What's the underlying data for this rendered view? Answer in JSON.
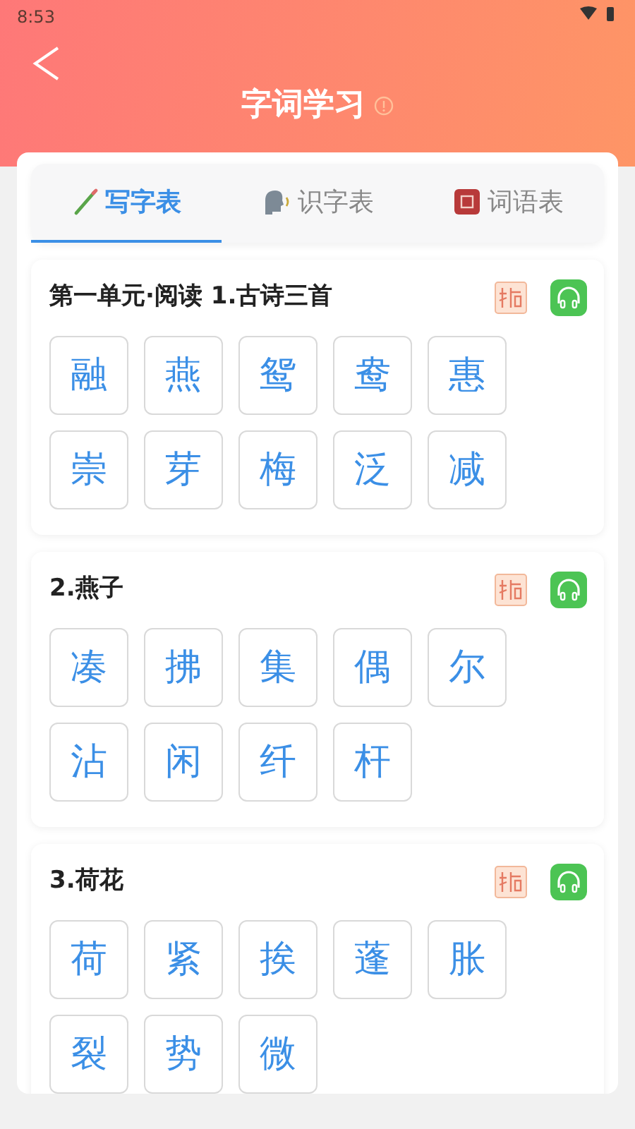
{
  "status_bar": {
    "time": "8:53"
  },
  "header": {
    "title": "字词学习"
  },
  "tabs": [
    {
      "label": "写字表",
      "kind": "pencil",
      "selected": true
    },
    {
      "label": "识字表",
      "kind": "speaker",
      "selected": false
    },
    {
      "label": "词语表",
      "kind": "book",
      "selected": false
    }
  ],
  "sections": [
    {
      "title": "第一单元·阅读 1.古诗三首",
      "characters": [
        "融",
        "燕",
        "鸳",
        "鸯",
        "惠",
        "崇",
        "芽",
        "梅",
        "泛",
        "减"
      ]
    },
    {
      "title": "2.燕子",
      "characters": [
        "凑",
        "拂",
        "集",
        "偶",
        "尔",
        "沾",
        "闲",
        "纤",
        "杆"
      ]
    },
    {
      "title": "3.荷花",
      "characters": [
        "荷",
        "紧",
        "挨",
        "蓬",
        "胀",
        "裂",
        "势",
        "微"
      ]
    }
  ]
}
